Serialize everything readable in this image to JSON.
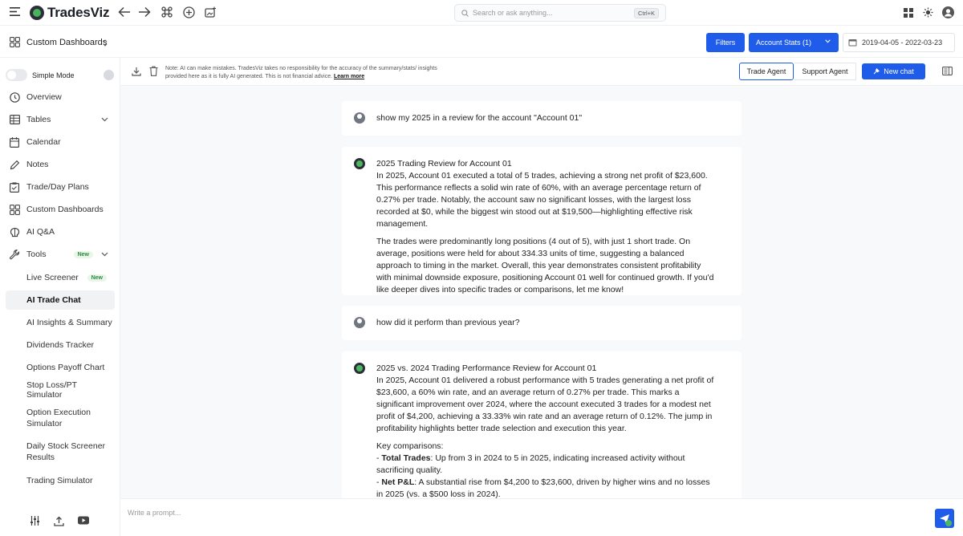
{
  "app": {
    "logo_text": "TradesViz"
  },
  "topbar": {
    "search_placeholder": "Search or ask anything...",
    "search_shortcut": "Ctrl+K"
  },
  "subbar": {
    "dashboard_title": "Custom Dashboards",
    "filters_label": "Filters",
    "account_stats_label": "Account Stats (1)",
    "date_range": "2019-04-05 - 2022-03-23"
  },
  "sidebar": {
    "simple_mode_label": "Simple Mode",
    "items": [
      {
        "label": "Overview",
        "icon": "clock-icon"
      },
      {
        "label": "Tables",
        "icon": "table-icon"
      },
      {
        "label": "Calendar",
        "icon": "calendar-icon"
      },
      {
        "label": "Notes",
        "icon": "pencil-icon"
      },
      {
        "label": "Trade/Day Plans",
        "icon": "clipboard-icon"
      },
      {
        "label": "Custom Dashboards",
        "icon": "dashboard-icon"
      },
      {
        "label": "AI Q&A",
        "icon": "brain-icon"
      },
      {
        "label": "Tools",
        "icon": "wrench-icon",
        "badge": "New"
      }
    ],
    "tools": [
      {
        "label": "Live Screener",
        "badge": "New"
      },
      {
        "label": "AI Trade Chat"
      },
      {
        "label": "AI Insights & Summary"
      },
      {
        "label": "Dividends Tracker"
      },
      {
        "label": "Options Payoff Chart"
      },
      {
        "label": "Stop Loss/PT Simulator"
      },
      {
        "label": "Option Execution Simulator"
      },
      {
        "label": "Daily Stock Screener Results"
      },
      {
        "label": "Trading Simulator"
      }
    ]
  },
  "chat_toolbar": {
    "disclaimer": "Note: AI can make mistakes. TradesViz takes no responsibility for the accuracy of the summary/stats/ insights provided here as it is fully AI generated. This is not financial advice.",
    "learn_more": "Learn more",
    "trade_agent": "Trade Agent",
    "support_agent": "Support Agent",
    "new_chat": "New chat"
  },
  "messages": [
    {
      "role": "user",
      "text": "show my 2025 in a review for the account \"Account 01\""
    },
    {
      "role": "assistant",
      "title": "2025 Trading Review for Account 01",
      "p1": "In 2025, Account 01 executed a total of 5 trades, achieving a strong net profit of $23,600. This performance reflects a solid win rate of 60%, with an average percentage return of 0.27% per trade. Notably, the account saw no significant losses, with the largest loss recorded at $0, while the biggest win stood out at $19,500—highlighting effective risk management.",
      "p2": "The trades were predominantly long positions (4 out of 5), with just 1 short trade. On average, positions were held for about 334.33 units of time, suggesting a balanced approach to timing in the market. Overall, this year demonstrates consistent profitability with minimal downside exposure, positioning Account 01 well for continued growth. If you'd like deeper dives into specific trades or comparisons, let me know!"
    },
    {
      "role": "user",
      "text": "how did it perform than previous year?"
    },
    {
      "role": "assistant",
      "title": "2025 vs. 2024 Trading Performance Review for Account 01",
      "p1": "In 2025, Account 01 delivered a robust performance with 5 trades generating a net profit of $23,600, a 60% win rate, and an average return of 0.27% per trade. This marks a significant improvement over 2024, where the account executed 3 trades for a modest net profit of $4,200, achieving a 33.33% win rate and an average return of 0.12%. The jump in profitability highlights better trade selection and execution this year.",
      "key_heading": "Key comparisons:",
      "b1_label": "Total Trades",
      "b1_text": ": Up from 3 in 2024 to 5 in 2025, indicating increased activity without sacrificing quality.",
      "b2_label": "Net P&L",
      "b2_text": ": A substantial rise from $4,200 to $23,600, driven by higher wins and no losses in 2025 (vs. a $500 loss in 2024)."
    }
  ],
  "prompt": {
    "placeholder": "Write a prompt..."
  }
}
